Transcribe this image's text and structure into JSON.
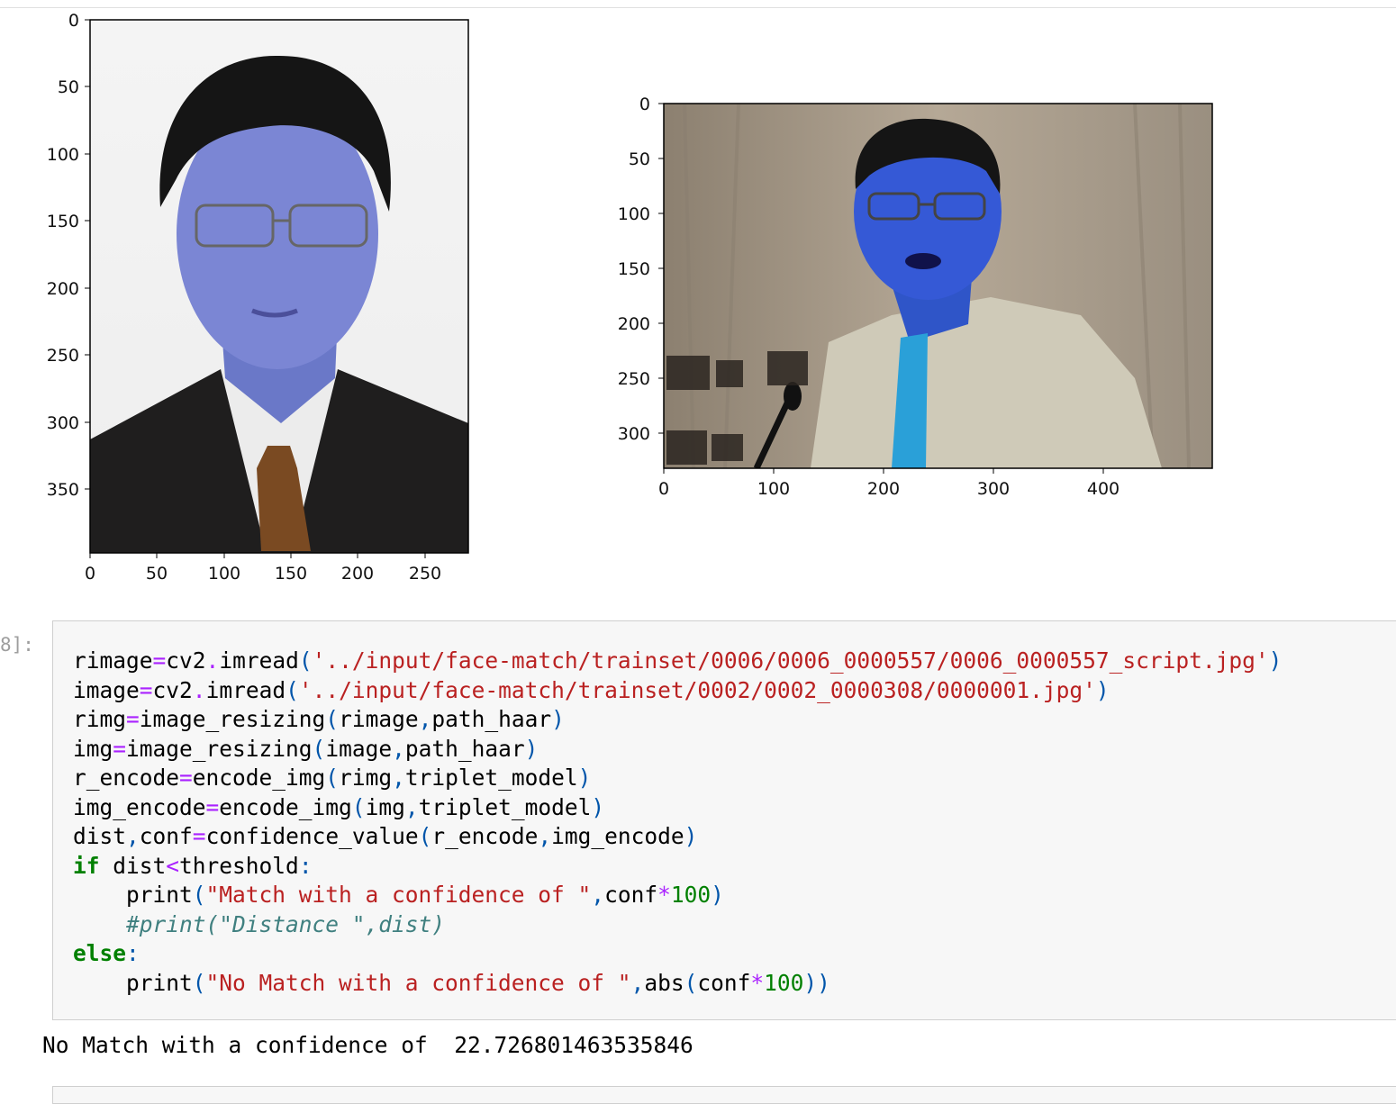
{
  "figures": [
    {
      "image_desc": "portrait-blue-tinted",
      "y_ticks": [
        "0",
        "50",
        "100",
        "150",
        "200",
        "250",
        "300",
        "350"
      ],
      "x_ticks": [
        "0",
        "50",
        "100",
        "150",
        "200",
        "250"
      ]
    },
    {
      "image_desc": "speaker-blue-tinted",
      "y_ticks": [
        "0",
        "50",
        "100",
        "150",
        "200",
        "250",
        "300"
      ],
      "x_ticks": [
        "0",
        "100",
        "200",
        "300",
        "400"
      ]
    }
  ],
  "cell": {
    "prompt": "8]:",
    "lines": [
      [
        [
          "fn",
          "rimage"
        ],
        [
          "op",
          "="
        ],
        [
          "fn",
          "cv2"
        ],
        [
          "op",
          "."
        ],
        [
          "fn",
          "imread"
        ],
        [
          "paren",
          "("
        ],
        [
          "str",
          "'../input/face-match/trainset/0006/0006_0000557/0006_0000557_script.jpg'"
        ],
        [
          "paren",
          ")"
        ]
      ],
      [
        [
          "fn",
          "image"
        ],
        [
          "op",
          "="
        ],
        [
          "fn",
          "cv2"
        ],
        [
          "op",
          "."
        ],
        [
          "fn",
          "imread"
        ],
        [
          "paren",
          "("
        ],
        [
          "str",
          "'../input/face-match/trainset/0002/0002_0000308/0000001.jpg'"
        ],
        [
          "paren",
          ")"
        ]
      ],
      [
        [
          "fn",
          "rimg"
        ],
        [
          "op",
          "="
        ],
        [
          "fn",
          "image_resizing"
        ],
        [
          "paren",
          "("
        ],
        [
          "fn",
          "rimage"
        ],
        [
          "paren",
          ","
        ],
        [
          "fn",
          "path_haar"
        ],
        [
          "paren",
          ")"
        ]
      ],
      [
        [
          "fn",
          "img"
        ],
        [
          "op",
          "="
        ],
        [
          "fn",
          "image_resizing"
        ],
        [
          "paren",
          "("
        ],
        [
          "fn",
          "image"
        ],
        [
          "paren",
          ","
        ],
        [
          "fn",
          "path_haar"
        ],
        [
          "paren",
          ")"
        ]
      ],
      [
        [
          "fn",
          "r_encode"
        ],
        [
          "op",
          "="
        ],
        [
          "fn",
          "encode_img"
        ],
        [
          "paren",
          "("
        ],
        [
          "fn",
          "rimg"
        ],
        [
          "paren",
          ","
        ],
        [
          "fn",
          "triplet_model"
        ],
        [
          "paren",
          ")"
        ]
      ],
      [
        [
          "fn",
          "img_encode"
        ],
        [
          "op",
          "="
        ],
        [
          "fn",
          "encode_img"
        ],
        [
          "paren",
          "("
        ],
        [
          "fn",
          "img"
        ],
        [
          "paren",
          ","
        ],
        [
          "fn",
          "triplet_model"
        ],
        [
          "paren",
          ")"
        ]
      ],
      [
        [
          "fn",
          "dist"
        ],
        [
          "paren",
          ","
        ],
        [
          "fn",
          "conf"
        ],
        [
          "op",
          "="
        ],
        [
          "fn",
          "confidence_value"
        ],
        [
          "paren",
          "("
        ],
        [
          "fn",
          "r_encode"
        ],
        [
          "paren",
          ","
        ],
        [
          "fn",
          "img_encode"
        ],
        [
          "paren",
          ")"
        ]
      ],
      [
        [
          "kw",
          "if"
        ],
        [
          "fn",
          " dist"
        ],
        [
          "op",
          "<"
        ],
        [
          "fn",
          "threshold"
        ],
        [
          "paren",
          ":"
        ]
      ],
      [
        [
          "fn",
          "    print"
        ],
        [
          "paren",
          "("
        ],
        [
          "str",
          "\"Match with a confidence of \""
        ],
        [
          "paren",
          ","
        ],
        [
          "fn",
          "conf"
        ],
        [
          "op",
          "*"
        ],
        [
          "num",
          "100"
        ],
        [
          "paren",
          ")"
        ]
      ],
      [
        [
          "comment",
          "    #print(\"Distance \",dist)"
        ]
      ],
      [
        [
          "kw",
          "else"
        ],
        [
          "paren",
          ":"
        ]
      ],
      [
        [
          "fn",
          "    print"
        ],
        [
          "paren",
          "("
        ],
        [
          "str",
          "\"No Match with a confidence of \""
        ],
        [
          "paren",
          ","
        ],
        [
          "fn",
          "abs"
        ],
        [
          "paren",
          "("
        ],
        [
          "fn",
          "conf"
        ],
        [
          "op",
          "*"
        ],
        [
          "num",
          "100"
        ],
        [
          "paren",
          "))"
        ]
      ]
    ]
  },
  "output_text": "No Match with a confidence of  22.726801463535846"
}
